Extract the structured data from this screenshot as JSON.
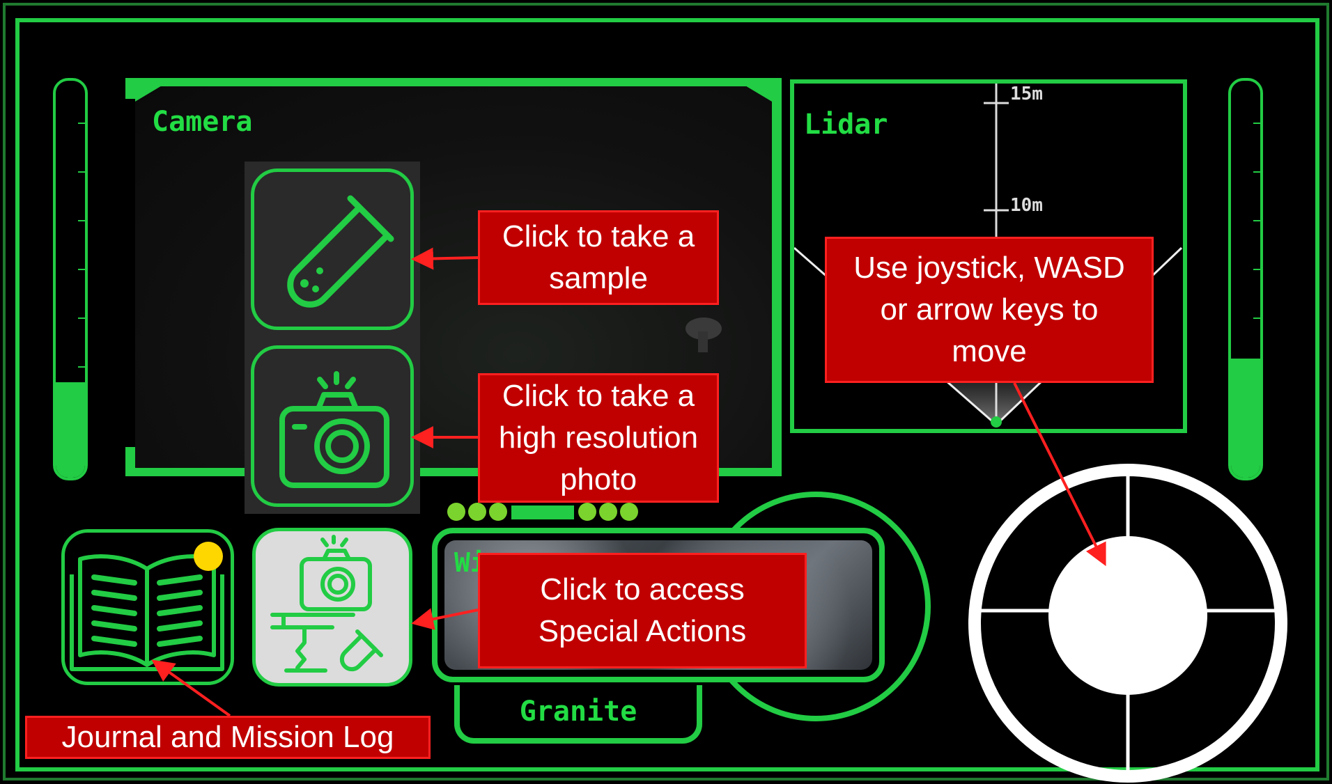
{
  "camera_panel": {
    "title": "Camera"
  },
  "lidar_panel": {
    "title": "Lidar",
    "range_labels": [
      "15m",
      "10m"
    ]
  },
  "sample_viewer": {
    "label": "Granite",
    "partial_title": "Wi..."
  },
  "gauges": {
    "left_level": 0.24,
    "right_level": 0.3
  },
  "callouts": {
    "sample": [
      "Click to take a",
      "sample"
    ],
    "photo": [
      "Click to take a",
      "high resolution",
      "photo"
    ],
    "special": [
      "Click to access",
      "Special Actions"
    ],
    "joystick": [
      "Use joystick, WASD",
      "or arrow keys to",
      "move"
    ],
    "journal": [
      "Journal and Mission Log"
    ]
  },
  "icons": {
    "sample_button": "test-tube-icon",
    "photo_button": "camera-icon",
    "special_actions_button": "camera-drill-tube-icon",
    "journal_button": "open-book-icon",
    "notification": "notification-dot-icon",
    "joystick": "joystick-icon"
  },
  "colors": {
    "hud_green": "#22cc44",
    "callout_red": "#c00000",
    "notification_yellow": "#ffd700"
  }
}
